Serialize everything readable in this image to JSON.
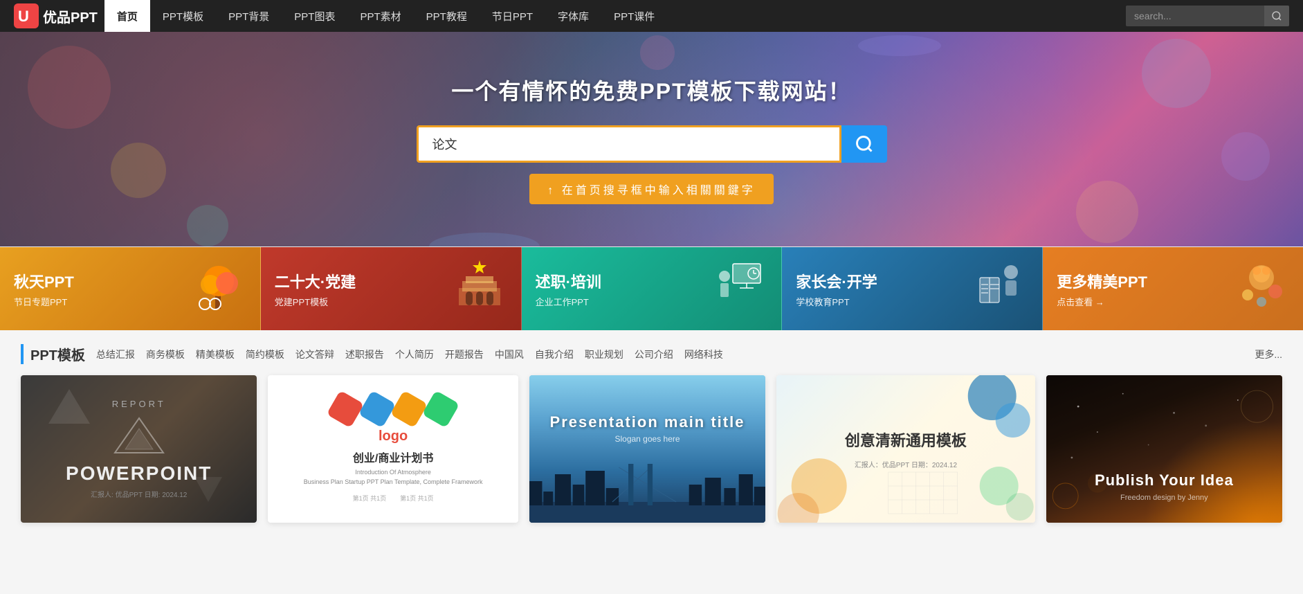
{
  "brand": {
    "name": "优品PPT",
    "logo_symbol": "U"
  },
  "navbar": {
    "items": [
      {
        "label": "首页",
        "active": true
      },
      {
        "label": "PPT模板",
        "active": false
      },
      {
        "label": "PPT背景",
        "active": false
      },
      {
        "label": "PPT图表",
        "active": false
      },
      {
        "label": "PPT素材",
        "active": false
      },
      {
        "label": "PPT教程",
        "active": false
      },
      {
        "label": "节日PPT",
        "active": false
      },
      {
        "label": "字体库",
        "active": false
      },
      {
        "label": "PPT课件",
        "active": false
      }
    ],
    "search_placeholder": "search..."
  },
  "hero": {
    "title": "一个有情怀的免费PPT模板下载网站！",
    "search_value": "论文",
    "hint": "↑ 在首页搜寻框中输入相關關鍵字"
  },
  "categories": [
    {
      "title": "秋天PPT",
      "sub": "节日专题PPT",
      "color": "#E8A020",
      "emoji": "🍂"
    },
    {
      "title": "二十大·党建",
      "sub": "党建PPT模板",
      "color": "#C0392B",
      "emoji": "🏛"
    },
    {
      "title": "述职·培训",
      "sub": "企业工作PPT",
      "color": "#1ABC9C",
      "emoji": "📊"
    },
    {
      "title": "家长会·开学",
      "sub": "学校教育PPT",
      "color": "#2980B9",
      "emoji": "📚"
    },
    {
      "title": "更多精美PPT",
      "sub": "点击查看 →",
      "color": "#E67E22",
      "emoji": "🎉"
    }
  ],
  "template_section": {
    "title": "PPT模板",
    "tags": [
      "总结汇报",
      "商务模板",
      "精美模板",
      "简约模板",
      "论文答辩",
      "述职报告",
      "个人简历",
      "开题报告",
      "中国风",
      "自我介绍",
      "职业规划",
      "公司介绍",
      "网络科技"
    ],
    "more_label": "更多...",
    "cards": [
      {
        "id": 1,
        "type": "dark-report",
        "report_label": "REPORT",
        "main_label": "POWERPOINT",
        "sub_label": "汇报人: 优品PPT  日期: 2024.12"
      },
      {
        "id": 2,
        "type": "business-plan",
        "logo_label": "logo",
        "title": "创业/商业计划书",
        "desc1": "Introduction Of Atmosphere",
        "desc2": "Business Plan Startup PPT Plan Template, Complete Framework"
      },
      {
        "id": 3,
        "type": "city",
        "main_label": "Presentation main title",
        "sub_label": "Slogan goes here"
      },
      {
        "id": 4,
        "type": "creative",
        "title": "创意清新通用模板",
        "info": "汇报人：优品PPT  日期：2024.12"
      },
      {
        "id": 5,
        "type": "dark-publish",
        "main_label": "Publish Your Idea",
        "sub_label": "Freedom design by Jenny"
      }
    ]
  }
}
